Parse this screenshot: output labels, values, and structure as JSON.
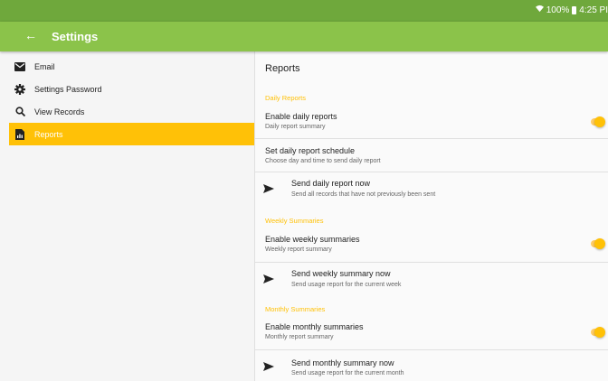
{
  "status": {
    "battery": "100%",
    "time": "4:25 PI"
  },
  "appbar": {
    "back_icon": "arrow-left-icon",
    "title": "Settings"
  },
  "sidebar": {
    "items": [
      {
        "label": "Email",
        "icon": "envelope-icon"
      },
      {
        "label": "Settings Password",
        "icon": "gear-icon"
      },
      {
        "label": "View Records",
        "icon": "search-icon"
      },
      {
        "label": "Reports",
        "icon": "report-icon"
      }
    ],
    "active": "Reports"
  },
  "content": {
    "heading": "Reports",
    "daily": {
      "section": "Daily Reports",
      "enable": {
        "title": "Enable daily reports",
        "subtitle": "Daily report summary",
        "on": true
      },
      "schedule": {
        "title": "Set daily report schedule",
        "subtitle": "Choose day and time to send daily report"
      },
      "send": {
        "title": "Send daily report now",
        "subtitle": "Send all records that have not previously been sent"
      }
    },
    "weekly": {
      "section": "Weekly Summaries",
      "enable": {
        "title": "Enable weekly summaries",
        "subtitle": "Weekly report summary",
        "on": true
      },
      "send": {
        "title": "Send weekly summary now",
        "subtitle": "Send usage report for the current week"
      }
    },
    "monthly": {
      "section": "Monthly Summaries",
      "enable": {
        "title": "Enable monthly summaries",
        "subtitle": "Monthly report summary",
        "on": true
      },
      "send": {
        "title": "Send monthly summary now",
        "subtitle": "Send usage report for the current month"
      }
    }
  },
  "colors": {
    "statusbar": "#6fa83c",
    "appbar": "#8bc34a",
    "accent": "#ffc107"
  }
}
